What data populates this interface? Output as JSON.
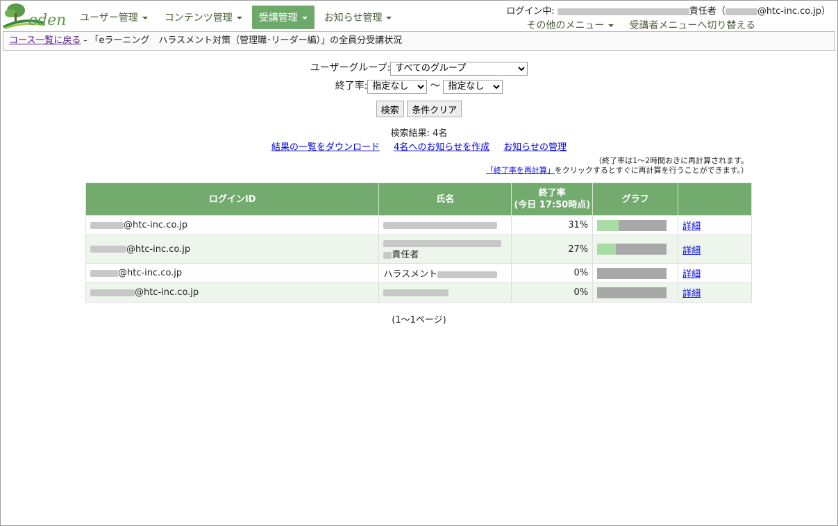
{
  "app": {
    "logo_text": "eden"
  },
  "nav": {
    "items": [
      {
        "label": "ユーザー管理",
        "active": false
      },
      {
        "label": "コンテンツ管理",
        "active": false
      },
      {
        "label": "受講管理",
        "active": true
      },
      {
        "label": "お知らせ管理",
        "active": false
      }
    ]
  },
  "user": {
    "login_prefix": "ログイン中:",
    "role_text": "責任者",
    "email_open": "（",
    "email_suffix": "@htc-inc.co.jp）"
  },
  "submenu": {
    "other_menu": "その他のメニュー",
    "switch_label": "受講者メニューへ切り替える"
  },
  "breadcrumb": {
    "back_link": "コース一覧に戻る",
    "separator": " - ",
    "title": "「eラーニング　ハラスメント対策（管理職･リーダー編）」の全員分受講状況"
  },
  "filters": {
    "group_label": "ユーザーグループ:",
    "group_value": "すべてのグループ",
    "rate_label": "終了率:",
    "rate_from": "指定なし",
    "tilde": "～",
    "rate_to": "指定なし",
    "search_button": "検索",
    "clear_button": "条件クリア"
  },
  "results": {
    "count_text": "検索結果: 4名",
    "download_link": "結果の一覧をダウンロード",
    "notify_link": "4名へのお知らせを作成",
    "manage_link": "お知らせの管理",
    "note_line1": "（終了率は1～2時間おきに再計算されます。",
    "recalc_link": "「終了率を再計算」",
    "note_line2": "をクリックするとすぐに再計算を行うことができます。）"
  },
  "table": {
    "headers": {
      "login_id": "ログインID",
      "name": "氏名",
      "rate": "終了率",
      "rate_sub": "(今日 17:50時点)",
      "graph": "グラフ"
    },
    "rows": [
      {
        "login_suffix": "@htc-inc.co.jp",
        "name_text": "",
        "rate": "31%",
        "rate_value": 31,
        "detail": "詳細"
      },
      {
        "login_suffix": "@htc-inc.co.jp",
        "name_text": "責任者",
        "rate": "27%",
        "rate_value": 27,
        "detail": "詳細"
      },
      {
        "login_suffix": "@htc-inc.co.jp",
        "name_text": "ハラスメント",
        "rate": "0%",
        "rate_value": 0,
        "detail": "詳細"
      },
      {
        "login_suffix": "@htc-inc.co.jp",
        "name_text": "",
        "rate": "0%",
        "rate_value": 0,
        "detail": "詳細"
      }
    ]
  },
  "pager": {
    "text": "(1～1ページ)"
  },
  "colors": {
    "header_green": "#72ab6d",
    "nav_active": "#6ea96c",
    "bar_fill": "#a8dca4",
    "bar_bg": "#a8a8a8"
  }
}
